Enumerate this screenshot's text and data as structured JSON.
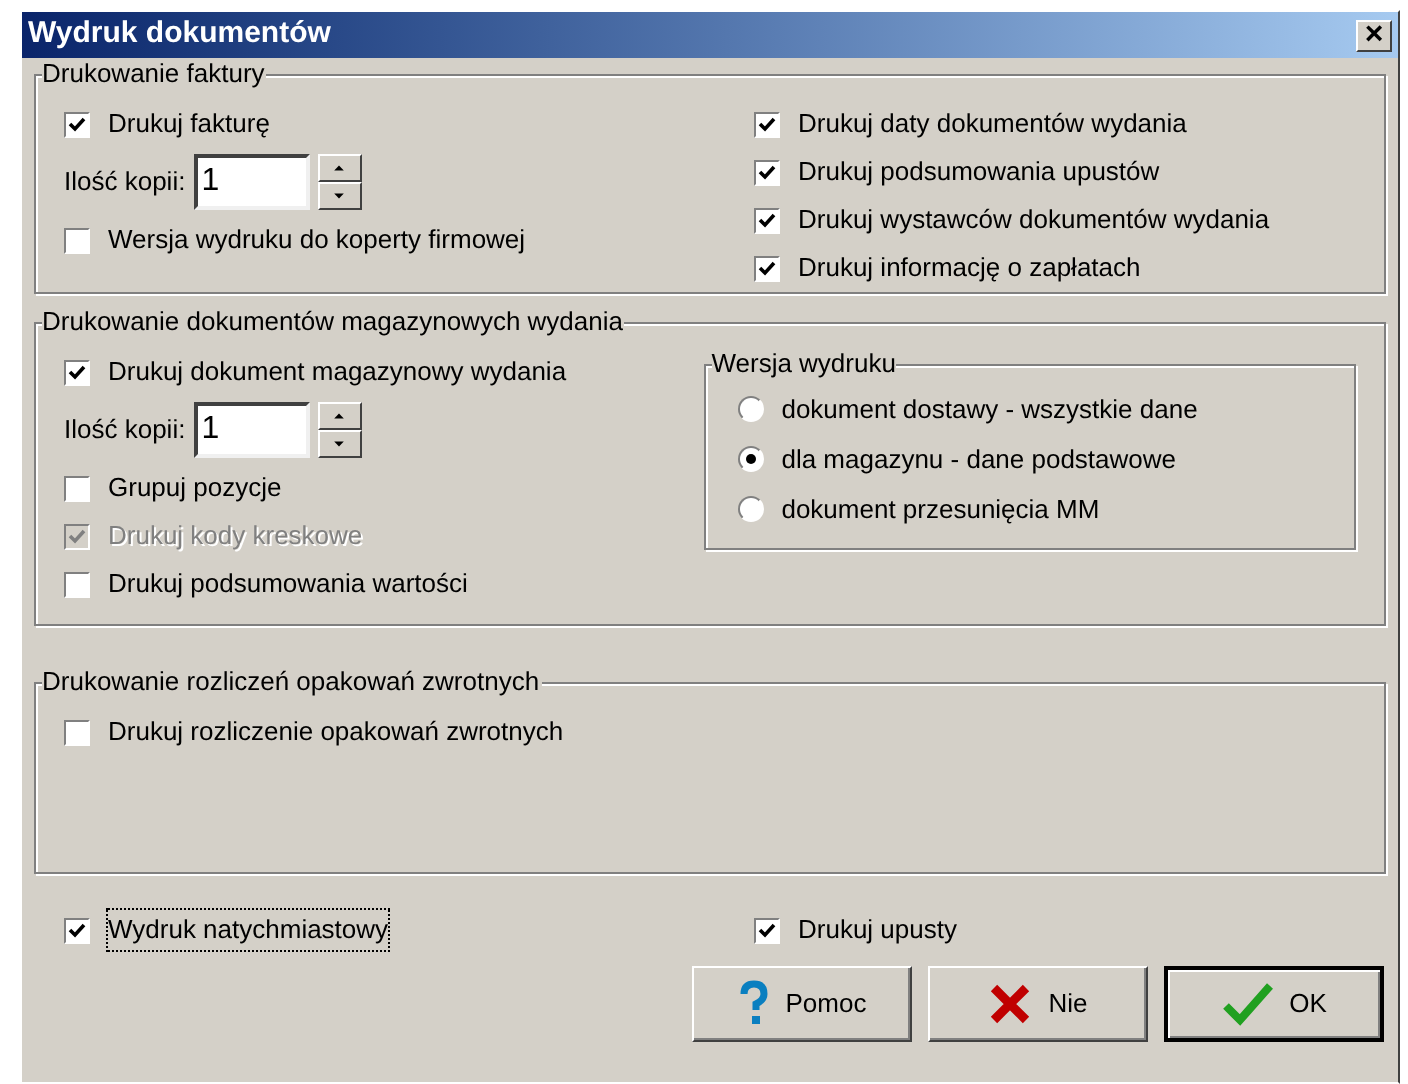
{
  "window": {
    "title": "Wydruk dokumentów",
    "close_glyph": "×"
  },
  "invoice_group": {
    "title": "Drukowanie faktury",
    "left": [
      {
        "kind": "checkbox",
        "label": "Drukuj fakturę",
        "checked": true,
        "disabled": false
      },
      {
        "kind": "spinner",
        "label": "Ilość kopii:",
        "value": "1"
      },
      {
        "kind": "checkbox",
        "label": "Wersja wydruku do koperty firmowej",
        "checked": false,
        "disabled": false
      }
    ],
    "right": [
      {
        "kind": "checkbox",
        "label": "Drukuj daty dokumentów wydania",
        "checked": true,
        "disabled": false
      },
      {
        "kind": "checkbox",
        "label": "Drukuj podsumowania upustów",
        "checked": true,
        "disabled": false
      },
      {
        "kind": "checkbox",
        "label": "Drukuj wystawców dokumentów wydania",
        "checked": true,
        "disabled": false
      },
      {
        "kind": "checkbox",
        "label": "Drukuj informację o zapłatach",
        "checked": true,
        "disabled": false
      }
    ]
  },
  "warehouse_group": {
    "title": "Drukowanie dokumentów magazynowych wydania",
    "left": [
      {
        "kind": "checkbox",
        "label": "Drukuj dokument magazynowy wydania",
        "checked": true,
        "disabled": false
      },
      {
        "kind": "spinner",
        "label": "Ilość kopii:",
        "value": "1"
      },
      {
        "kind": "checkbox",
        "label": "Grupuj pozycje",
        "checked": false,
        "disabled": false
      },
      {
        "kind": "checkbox",
        "label": "Drukuj kody kreskowe",
        "checked": true,
        "disabled": true
      },
      {
        "kind": "checkbox",
        "label": "Drukuj podsumowania wartości",
        "checked": false,
        "disabled": false
      }
    ],
    "print_version": {
      "title": "Wersja wydruku",
      "options": [
        {
          "label": "dokument dostawy - wszystkie dane",
          "selected": false
        },
        {
          "label": "dla magazynu - dane podstawowe",
          "selected": true
        },
        {
          "label": "dokument przesunięcia MM",
          "selected": false
        }
      ]
    }
  },
  "returnables_group": {
    "title": "Drukowanie rozliczeń opakowań zwrotnych",
    "left": [
      {
        "kind": "checkbox",
        "label": "Drukuj rozliczenie opakowań zwrotnych",
        "checked": false,
        "disabled": false
      }
    ]
  },
  "bottom_options": [
    {
      "label": "Wydruk natychmiastowy",
      "checked": true,
      "focused": true
    },
    {
      "label": "Drukuj upusty",
      "checked": true,
      "focused": false
    }
  ],
  "buttons": [
    {
      "kind": "help",
      "label": "Pomoc",
      "default": false
    },
    {
      "kind": "cancel",
      "label": "Nie",
      "default": false
    },
    {
      "kind": "ok",
      "label": "OK",
      "default": true
    }
  ]
}
